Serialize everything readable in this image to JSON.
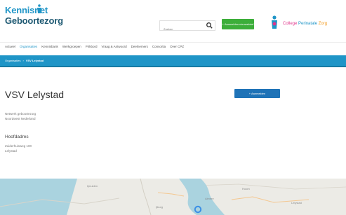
{
  "header": {
    "logo": {
      "line1": "Kennisnet",
      "line2": "Geboortezorg"
    },
    "search": {
      "placeholder": "Zoeken"
    },
    "signup_label": "+ Aanmelden nieuwsbrief",
    "partner": {
      "word1": "College",
      "word2": "Perinatale",
      "word3": "Zorg"
    }
  },
  "nav": {
    "items": [
      "Actueel",
      "Organisaties",
      "Kennisbank",
      "Werkgroepen",
      "Prikbord",
      "Vraag & Antwoord",
      "Deelnemers",
      "Consortia",
      "Over CPZ"
    ],
    "active_index": 1
  },
  "breadcrumb": {
    "items": [
      "Organisaties",
      "VSV Lelystad"
    ],
    "separator": "›"
  },
  "main": {
    "title": "VSV Lelystad",
    "add_button": "+ Aanmelden",
    "meta": [
      "Netwerk geboortezorg",
      "Noordwest Nederland"
    ],
    "address_heading": "Hoofdadres",
    "address": [
      "Zuiderhuisweg 100",
      "Lelystad"
    ]
  },
  "map": {
    "labels": [
      "Ijmuiden",
      "Ijburg",
      "Hoorn",
      "Almere",
      "Lelystad"
    ]
  },
  "colors": {
    "brand_blue": "#1f95c7",
    "dark_blue": "#1f5a73",
    "green": "#3cae3a",
    "button_blue": "#1f73b7",
    "cpz_pink": "#e0338a",
    "cpz_blue": "#1f95c7",
    "cpz_orange": "#f29a1d"
  }
}
